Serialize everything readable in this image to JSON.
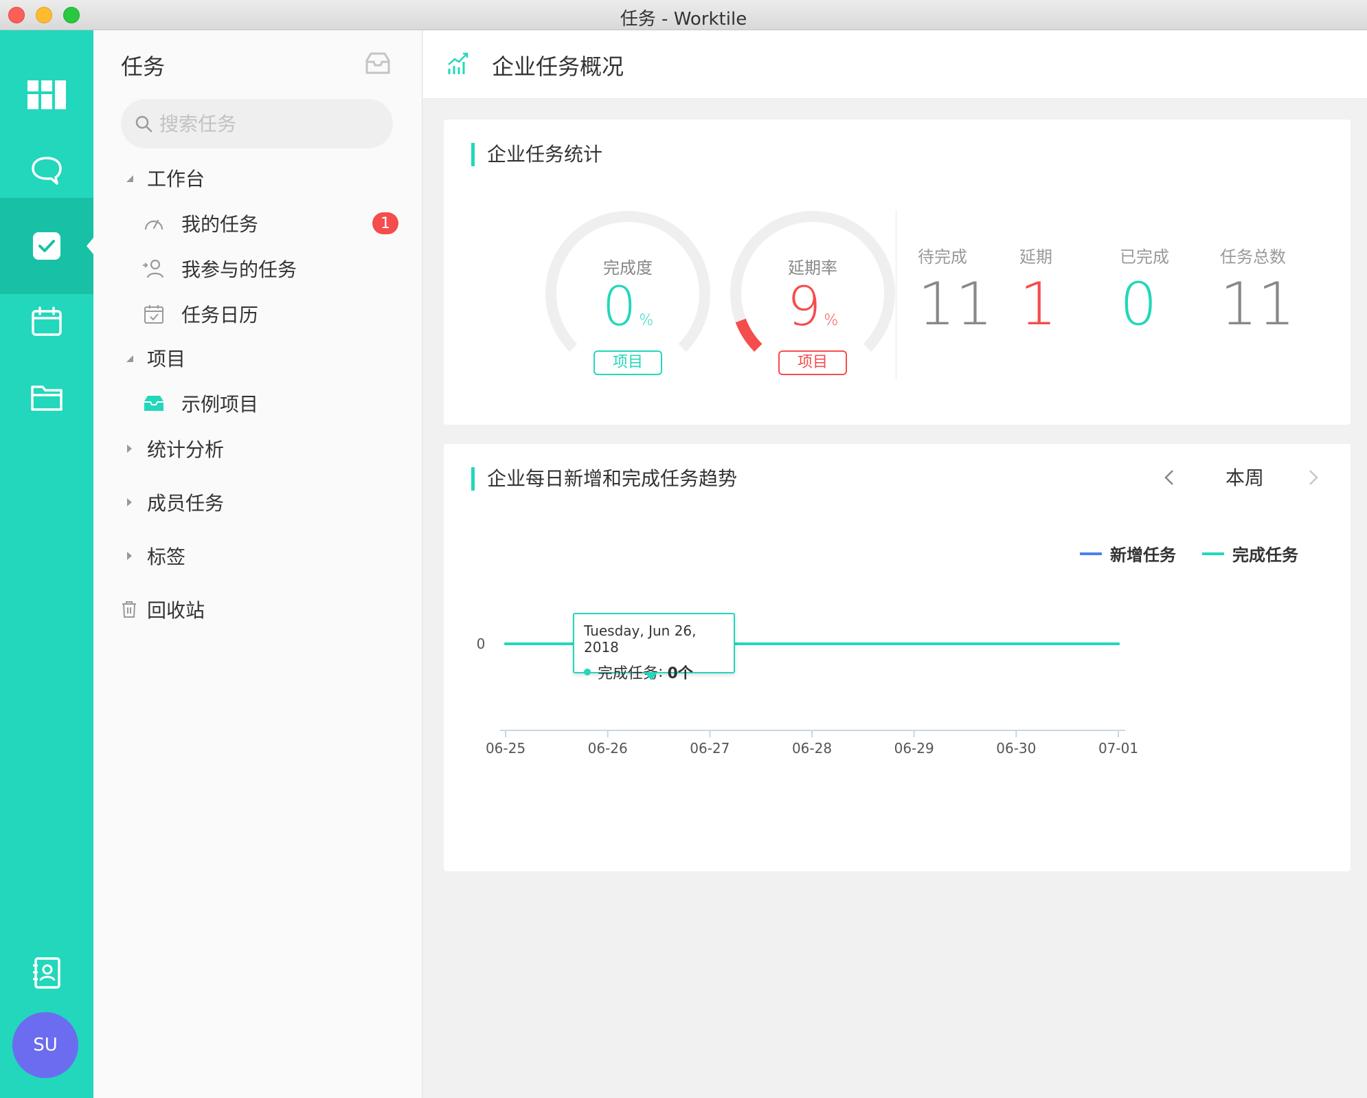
{
  "window": {
    "title": "任务 - Worktile"
  },
  "rail": {
    "items": [
      {
        "icon": "dashboard-icon"
      },
      {
        "icon": "chat-icon"
      },
      {
        "icon": "task-check-icon",
        "active": true
      },
      {
        "icon": "calendar-icon"
      },
      {
        "icon": "folder-icon"
      }
    ],
    "contacts_icon": "contacts-icon",
    "avatar_initials": "SU"
  },
  "nav": {
    "title": "任务",
    "search_placeholder": "搜索任务",
    "workbench": {
      "label": "工作台",
      "items": [
        {
          "label": "我的任务",
          "icon": "gauge-icon",
          "badge": "1"
        },
        {
          "label": "我参与的任务",
          "icon": "participant-icon"
        },
        {
          "label": "任务日历",
          "icon": "calendar-check-icon"
        }
      ]
    },
    "projects": {
      "label": "项目",
      "items": [
        {
          "label": "示例项目",
          "icon": "project-box-icon"
        }
      ]
    },
    "sections": [
      {
        "label": "统计分析"
      },
      {
        "label": "成员任务"
      },
      {
        "label": "标签"
      }
    ],
    "trash": {
      "label": "回收站"
    }
  },
  "header": {
    "title": "企业任务概况"
  },
  "stats_card": {
    "title": "企业任务统计",
    "completion": {
      "label": "完成度",
      "value": "0",
      "unit": "%",
      "tag": "项目",
      "percent": 0,
      "color": "#22d7bb"
    },
    "delay": {
      "label": "延期率",
      "value": "9",
      "unit": "%",
      "tag": "项目",
      "percent": 9,
      "color": "#f54c4c"
    },
    "stats": [
      {
        "label": "待完成",
        "value": "11",
        "color": "#888888"
      },
      {
        "label": "延期",
        "value": "1",
        "color": "#f54c4c"
      },
      {
        "label": "已完成",
        "value": "0",
        "color": "#22d7bb"
      },
      {
        "label": "任务总数",
        "value": "11",
        "color": "#888888"
      }
    ]
  },
  "trend_card": {
    "title": "企业每日新增和完成任务趋势",
    "period": "本周",
    "tooltip": {
      "date": "Tuesday, Jun 26, 2018",
      "series": "完成任务",
      "value": "0个"
    }
  },
  "chart_data": {
    "type": "line",
    "x": [
      "06-25",
      "06-26",
      "06-27",
      "06-28",
      "06-29",
      "06-30",
      "07-01"
    ],
    "series": [
      {
        "name": "新增任务",
        "values": [
          0,
          0,
          0,
          0,
          0,
          0,
          0
        ],
        "color": "#4a7ff0"
      },
      {
        "name": "完成任务",
        "values": [
          0,
          0,
          0,
          0,
          0,
          0,
          0
        ],
        "color": "#22d7bb"
      }
    ],
    "y_ticks": [
      "0"
    ],
    "legend": "top-right",
    "highlight_index": 1
  }
}
